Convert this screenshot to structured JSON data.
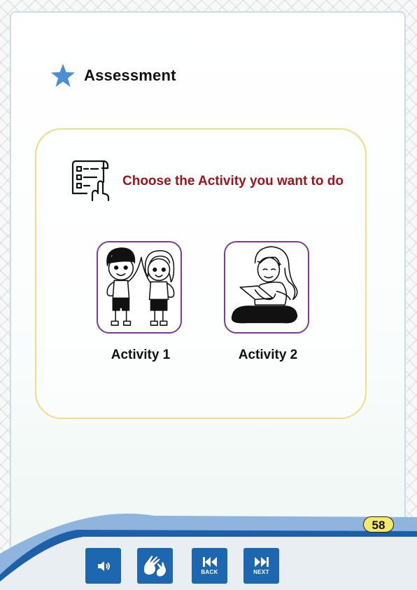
{
  "header": {
    "title": "Assessment",
    "icon": "star-icon",
    "star_color": "#4a8fd6"
  },
  "instruction": {
    "text": "Choose the Activity you want to do",
    "icon": "checklist-icon",
    "color": "#a5121c"
  },
  "activities": [
    {
      "label": "Activity 1",
      "image": "two-kids-high-five-illustration"
    },
    {
      "label": "Activity 2",
      "image": "girl-with-tablet-illustration"
    }
  ],
  "footer": {
    "page_number": "58",
    "buttons": [
      {
        "icon": "speaker-icon",
        "label": ""
      },
      {
        "icon": "sign-language-icon",
        "label": ""
      },
      {
        "icon": "back-icon",
        "label": "BACK"
      },
      {
        "icon": "next-icon",
        "label": "NEXT"
      }
    ]
  },
  "colors": {
    "accent_blue": "#1d67b1",
    "panel_border": "#f2dc84",
    "thumb_border": "#7b3b9c",
    "page_badge": "#f5e96b"
  }
}
